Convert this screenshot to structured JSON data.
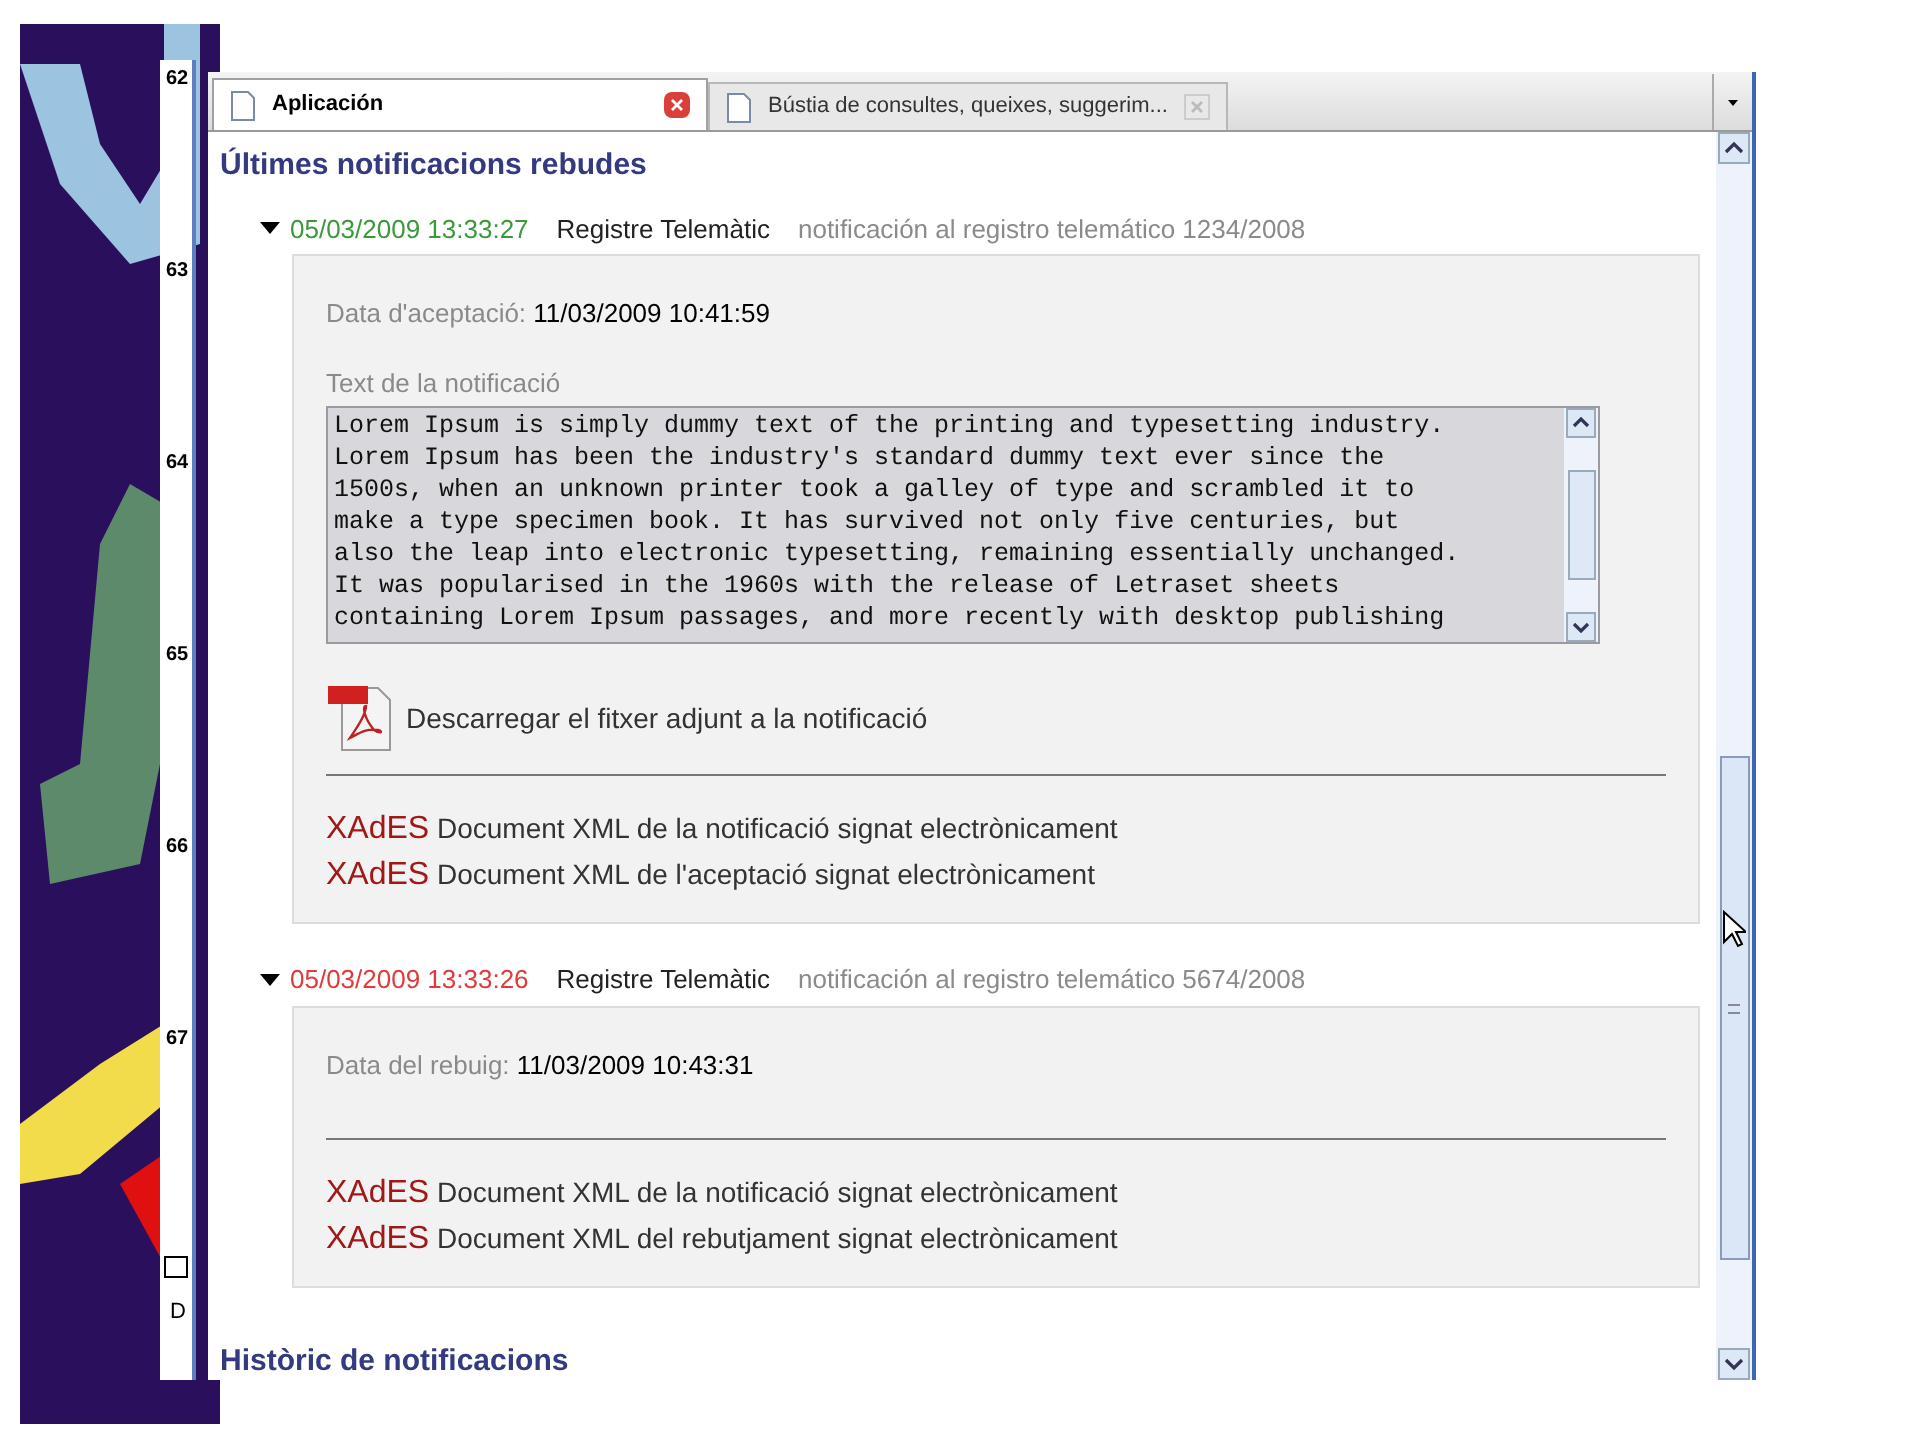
{
  "ruler": {
    "labels": [
      "62",
      "63",
      "64",
      "65",
      "66",
      "67"
    ],
    "fragment": "D"
  },
  "tabs": [
    {
      "label": "Aplicación",
      "selected": true
    },
    {
      "label": "Bústia de consultes, queixes, suggerim...",
      "selected": false
    }
  ],
  "heading": "Últimes notificacions rebudes",
  "notifications": [
    {
      "kind": "accepted",
      "expanded": true,
      "timestamp": "05/03/2009 13:33:27",
      "registry": "Registre Telemàtic",
      "subject": "notificación al registro telemático 1234/2008",
      "date_label": "Data d'aceptació:",
      "date_value": "11/03/2009 10:41:59",
      "text_label": "Text de la notificació",
      "text_lines": [
        "Lorem Ipsum is simply dummy text of the printing and typesetting industry.",
        "Lorem Ipsum has been the industry's standard dummy text ever since the",
        "1500s, when an unknown printer took a galley of type and scrambled it to",
        "make a type specimen book. It has survived not only five centuries, but",
        "also the leap into electronic typesetting, remaining essentially unchanged.",
        "It was popularised in the 1960s with the release of Letraset sheets",
        "containing Lorem Ipsum passages, and more recently with desktop publishing"
      ],
      "attachment": "Descarregar el fitxer adjunt a la notificació",
      "documents": [
        {
          "tag": "XAdES",
          "label": "Document XML de la notificació signat electrònicament"
        },
        {
          "tag": "XAdES",
          "label": "Document XML de l'aceptació signat electrònicament"
        }
      ]
    },
    {
      "kind": "rejected",
      "expanded": true,
      "timestamp": "05/03/2009 13:33:26",
      "registry": "Registre Telemàtic",
      "subject": "notificación al registro telemático 5674/2008",
      "date_label": "Data del rebuig:",
      "date_value": "11/03/2009 10:43:31",
      "documents": [
        {
          "tag": "XAdES",
          "label": "Document XML de la notificació signat electrònicament"
        },
        {
          "tag": "XAdES",
          "label": "Document XML del rebutjament signat electrònicament"
        }
      ]
    }
  ],
  "history_heading": "Històric de notificacions"
}
